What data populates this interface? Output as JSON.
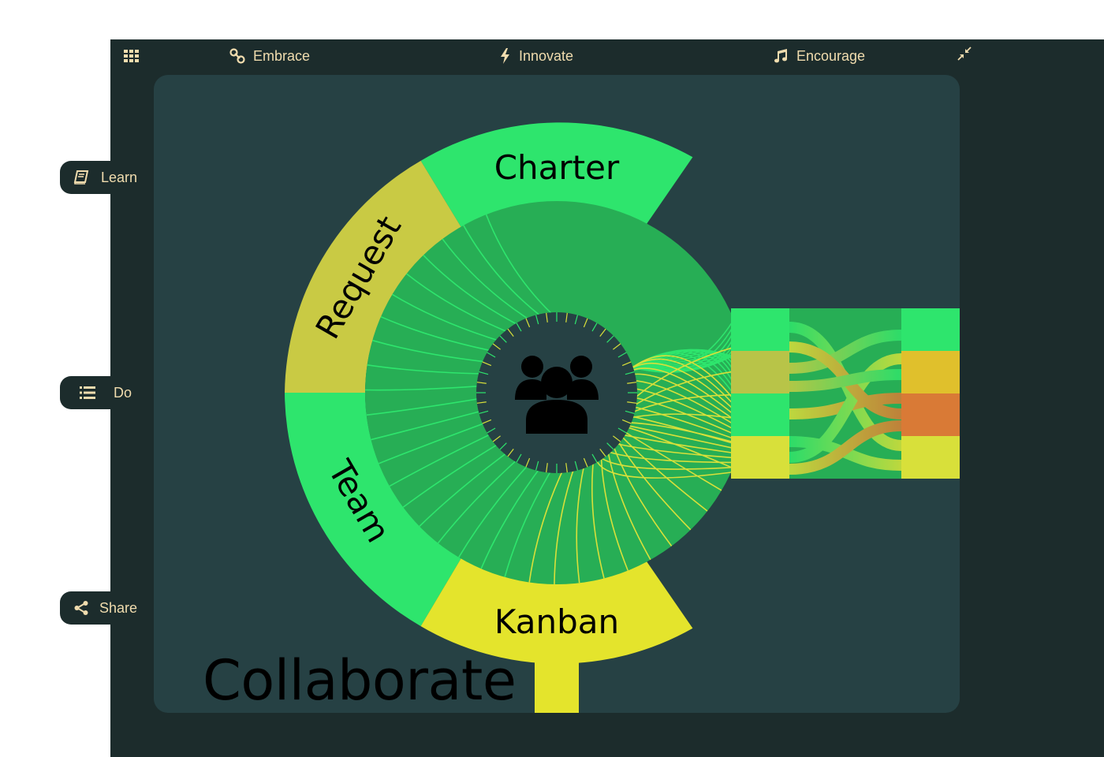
{
  "nav": {
    "grid_icon": "grid-icon",
    "items": [
      {
        "label": "Embrace",
        "icon": "link-icon"
      },
      {
        "label": "Innovate",
        "icon": "bolt-icon"
      },
      {
        "label": "Encourage",
        "icon": "music-note-icon"
      }
    ],
    "compress_icon": "compress-icon"
  },
  "side": [
    {
      "label": "Learn",
      "icon": "book-icon"
    },
    {
      "label": "Do",
      "icon": "list-icon"
    },
    {
      "label": "Share",
      "icon": "share-icon"
    }
  ],
  "diagram": {
    "title": "Collaborate",
    "segments": [
      {
        "label": "Charter",
        "color": "#2ee56d"
      },
      {
        "label": "Request",
        "color": "#c9ca44"
      },
      {
        "label": "Team",
        "color": "#2ee56d"
      },
      {
        "label": "Kanban",
        "color": "#e4e42c"
      }
    ],
    "center_icon": "users-icon",
    "flow_colors": [
      "#2ee56d",
      "#c9cc44",
      "#e0c02c",
      "#d97a36",
      "#d8e03a"
    ]
  },
  "colors": {
    "background": "#1c2c2c",
    "panel": "#264144",
    "accent_text": "#f0dcae",
    "inner_green": "#27ae55"
  }
}
